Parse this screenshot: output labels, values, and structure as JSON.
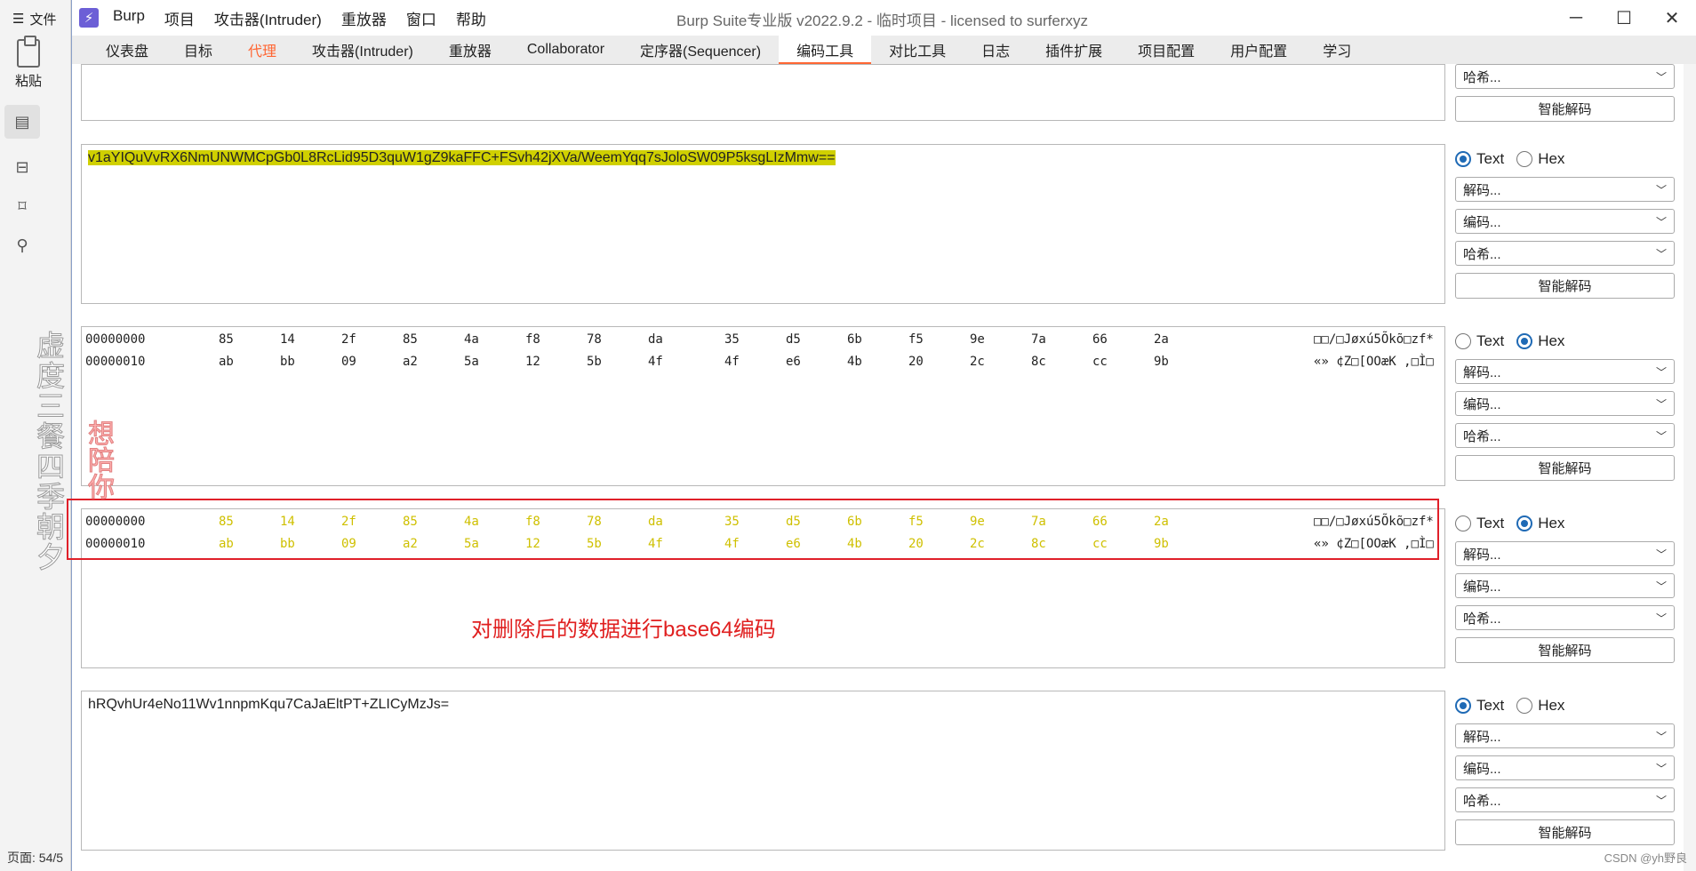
{
  "host": {
    "menu_label": "文件",
    "paste_label": "粘贴",
    "watermark": "虚度三餐四季朝夕",
    "status": "页面: 54/5"
  },
  "window": {
    "app": "Burp",
    "menu": [
      "项目",
      "攻击器(Intruder)",
      "重放器",
      "窗口",
      "帮助"
    ],
    "title": "Burp Suite专业版  v2022.9.2 - 临时项目 - licensed to surferxyz",
    "controls": [
      "─",
      "☐",
      "✕"
    ]
  },
  "tabs": [
    "仪表盘",
    "目标",
    "代理",
    "攻击器(Intruder)",
    "重放器",
    "Collaborator",
    "定序器(Sequencer)",
    "编码工具",
    "对比工具",
    "日志",
    "插件扩展",
    "项目配置",
    "用户配置",
    "学习"
  ],
  "panes": [
    {
      "text": ""
    },
    {
      "text": "v1aYIQuVvRX6NmUNWMCpGb0L8RcLid95D3quW1gZ9kaFFC+FSvh42jXVa/WeemYqq7sJoloSW09P5ksgLIzMmw=="
    },
    {
      "hex": [
        {
          "offset": "00000000",
          "bytes": [
            "85",
            "14",
            "2f",
            "85",
            "4a",
            "f8",
            "78",
            "da",
            "35",
            "d5",
            "6b",
            "f5",
            "9e",
            "7a",
            "66",
            "2a"
          ],
          "ascii": "□□/□Jøxú5Õkõ□zf*"
        },
        {
          "offset": "00000010",
          "bytes": [
            "ab",
            "bb",
            "09",
            "a2",
            "5a",
            "12",
            "5b",
            "4f",
            "4f",
            "e6",
            "4b",
            "20",
            "2c",
            "8c",
            "cc",
            "9b"
          ],
          "ascii": "«»    ¢Z□[OOæK ,□Ì□"
        }
      ]
    },
    {
      "hex": [
        {
          "offset": "00000000",
          "bytes": [
            "85",
            "14",
            "2f",
            "85",
            "4a",
            "f8",
            "78",
            "da",
            "35",
            "d5",
            "6b",
            "f5",
            "9e",
            "7a",
            "66",
            "2a"
          ],
          "ascii": "□□/□Jøxú5Õkõ□zf*"
        },
        {
          "offset": "00000010",
          "bytes": [
            "ab",
            "bb",
            "09",
            "a2",
            "5a",
            "12",
            "5b",
            "4f",
            "4f",
            "e6",
            "4b",
            "20",
            "2c",
            "8c",
            "cc",
            "9b"
          ],
          "ascii": "«»    ¢Z□[OOæK ,□Ì□"
        }
      ]
    },
    {
      "text": "hRQvhUr4eNo11Wv1nnpmKqu7CaJaEltPT+ZLICyMzJs="
    }
  ],
  "annotation": {
    "note": "对删除后的数据进行base64编码",
    "watermark": "想陪你"
  },
  "controls": {
    "text_label": "Text",
    "hex_label": "Hex",
    "decode_label": "解码...",
    "encode_label": "编码...",
    "hash_label": "哈希...",
    "smart_label": "智能解码",
    "modes": [
      "",
      "text",
      "hex",
      "hex",
      "text"
    ]
  },
  "footer": "CSDN @yh野良",
  "colors": {
    "accent": "#ff6633",
    "highlight": "#d0d000",
    "annot": "#e02020",
    "radio": "#1f6ab5"
  }
}
